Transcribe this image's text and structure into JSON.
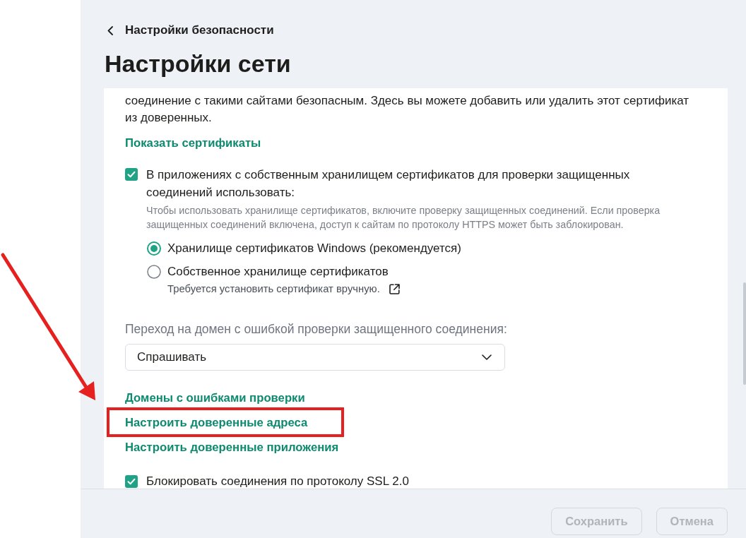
{
  "back_link": {
    "label": "Настройки безопасности"
  },
  "page_title": "Настройки сети",
  "description": "соединение с такими сайтами безопасным. Здесь вы можете добавить или удалить этот сертификат из доверенных.",
  "show_certificates_link": "Показать сертификаты",
  "cert_store_option": {
    "label": "В приложениях с собственным хранилищем сертификатов для проверки защищенных соединений использовать:",
    "checked": true,
    "hint": "Чтобы использовать хранилище сертификатов, включите проверку защищенных соединений. Если проверка защищенных соединений включена, доступ к сайтам по протоколу HTTPS может быть заблокирован.",
    "radios": [
      {
        "label": "Хранилище сертификатов Windows (рекомендуется)",
        "selected": true
      },
      {
        "label": "Собственное хранилище сертификатов",
        "selected": false,
        "note": "Требуется установить сертификат вручную."
      }
    ]
  },
  "domain_error_action": {
    "label": "Переход на домен с ошибкой проверки защищенного соединения:",
    "value": "Спрашивать"
  },
  "links": [
    {
      "label": "Домены с ошибками проверки",
      "annotated": false
    },
    {
      "label": "Настроить доверенные адреса",
      "annotated": true
    },
    {
      "label": "Настроить доверенные приложения",
      "annotated": false
    }
  ],
  "ssl2_option": {
    "label": "Блокировать соединения по протоколу SSL 2.0",
    "checked": true
  },
  "buttons": [
    {
      "label": "Сохранить",
      "disabled": true
    },
    {
      "label": "Отмена",
      "disabled": true
    }
  ]
}
